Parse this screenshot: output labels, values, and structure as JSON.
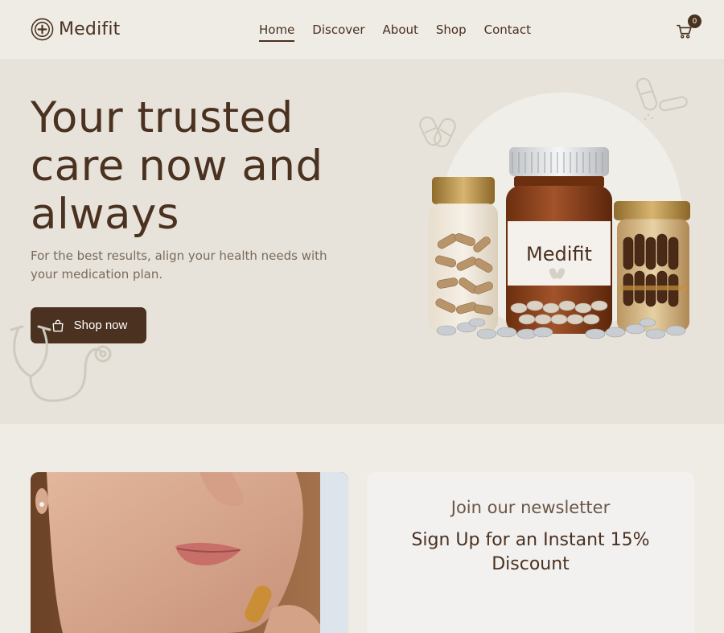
{
  "brand": {
    "name": "Medifit"
  },
  "nav": {
    "items": [
      {
        "label": "Home",
        "active": true
      },
      {
        "label": "Discover"
      },
      {
        "label": "About"
      },
      {
        "label": "Shop"
      },
      {
        "label": "Contact"
      }
    ]
  },
  "cart": {
    "count": "0",
    "icon": "cart-icon"
  },
  "hero": {
    "title": "Your trusted care now and always",
    "subtitle": "For the best results, align your health needs with your medication plan.",
    "cta_label": "Shop now",
    "bottle_label": "Medifit"
  },
  "newsletter": {
    "title": "Join our newsletter",
    "subtitle": "Sign Up for an Instant 15% Discount"
  },
  "colors": {
    "primary": "#4a3120",
    "hero_bg": "#e7e3da",
    "page_bg": "#efebe5"
  }
}
